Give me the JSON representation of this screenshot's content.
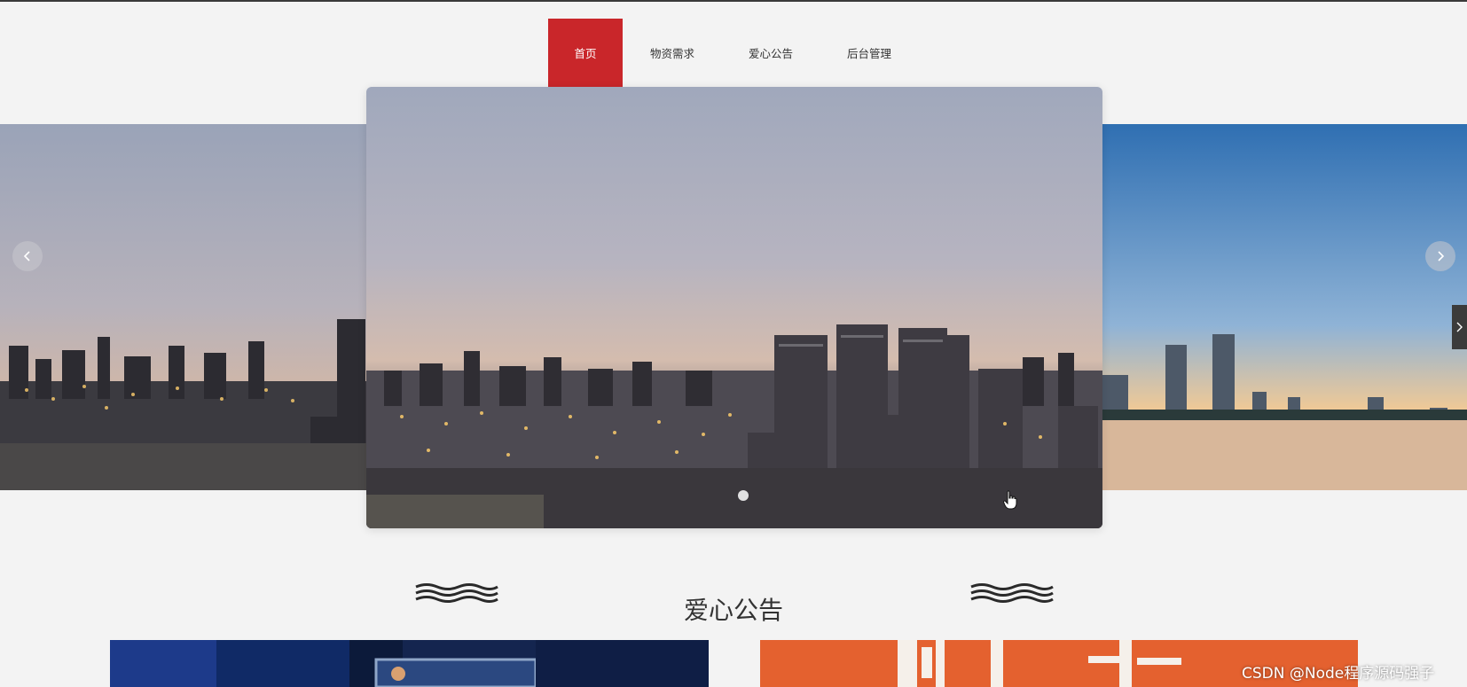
{
  "nav": {
    "items": [
      {
        "label": "首页",
        "active": true
      },
      {
        "label": "物资需求",
        "active": false
      },
      {
        "label": "爱心公告",
        "active": false
      },
      {
        "label": "后台管理",
        "active": false
      }
    ]
  },
  "carousel": {
    "slide_count": 3,
    "active_index": 0
  },
  "section": {
    "title": "爱心公告"
  },
  "watermark": "CSDN @Node程序源码强子",
  "colors": {
    "accent": "#c9262a",
    "background": "#f3f3f3"
  },
  "icons": {
    "prev": "chevron-left-icon",
    "next": "chevron-right-icon",
    "side": "chevron-right-icon",
    "cursor": "hand-cursor-icon",
    "decor": "wave-icon"
  }
}
